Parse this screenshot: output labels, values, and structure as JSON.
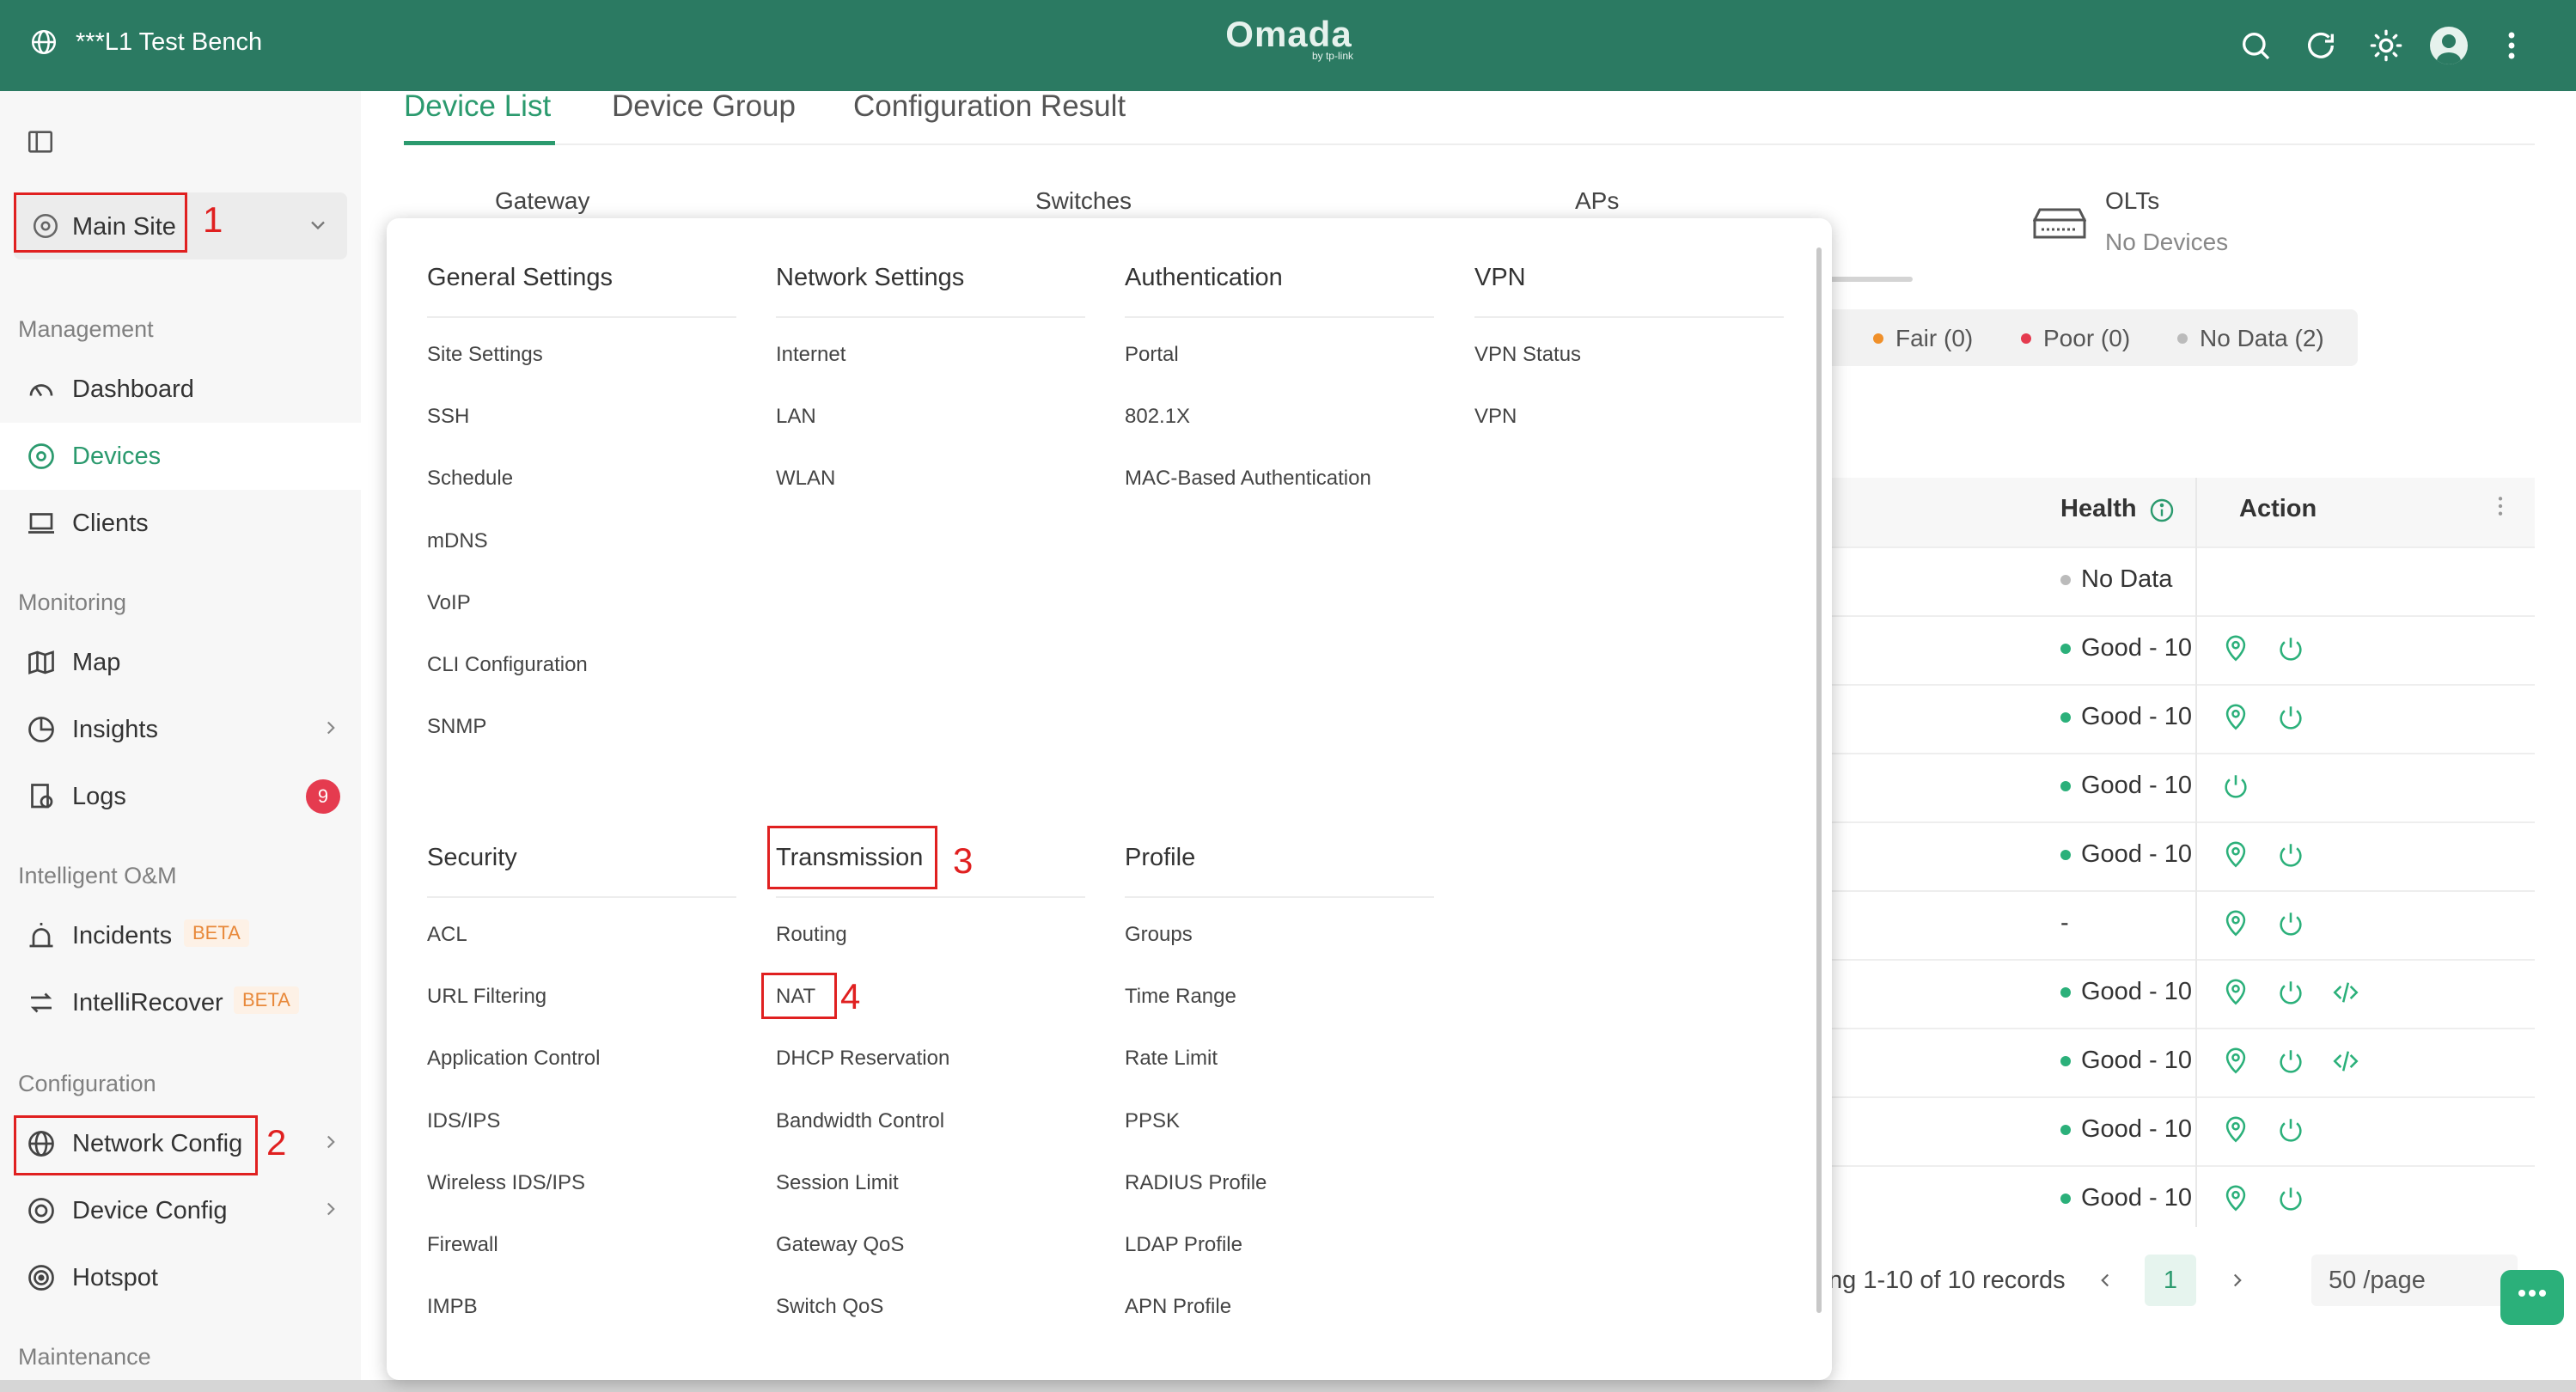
{
  "topbar": {
    "site_name": "***L1 Test Bench",
    "logo_text": "Omada",
    "logo_sub": "by tp-link",
    "icons": [
      "search-icon",
      "refresh-icon",
      "theme-icon",
      "avatar",
      "more-icon"
    ]
  },
  "sidebar": {
    "site_selector": "Main Site",
    "sections": {
      "management": "Management",
      "monitoring": "Monitoring",
      "intelligent": "Intelligent O&M",
      "configuration": "Configuration",
      "maintenance": "Maintenance"
    },
    "items": {
      "dashboard": "Dashboard",
      "devices": "Devices",
      "clients": "Clients",
      "map": "Map",
      "insights": "Insights",
      "logs": "Logs",
      "logs_badge": "9",
      "incidents": "Incidents",
      "intellirecover": "IntelliRecover",
      "beta": "BETA",
      "network_config": "Network Config",
      "device_config": "Device Config",
      "hotspot": "Hotspot"
    }
  },
  "annotations": {
    "n1": "1",
    "n2": "2",
    "n3": "3",
    "n4": "4"
  },
  "tabs": {
    "device_list": "Device List",
    "device_group": "Device Group",
    "config_result": "Configuration Result"
  },
  "categories": {
    "gateway": "Gateway",
    "switches": "Switches",
    "aps": "APs",
    "olts": "OLTs",
    "olts_sub": "No Devices"
  },
  "health_summary": {
    "fair": "Fair (0)",
    "poor": "Poor (0)",
    "nodata": "No Data (2)"
  },
  "table": {
    "health_header": "Health",
    "action_header": "Action",
    "rows": [
      {
        "health": "No Data",
        "status": "nodata",
        "actions": []
      },
      {
        "health": "Good - 10",
        "status": "good",
        "actions": [
          "locate-icon",
          "power-icon"
        ]
      },
      {
        "health": "Good - 10",
        "status": "good",
        "actions": [
          "locate-icon",
          "power-icon"
        ]
      },
      {
        "health": "Good - 10",
        "status": "good",
        "actions": [
          "power-icon"
        ]
      },
      {
        "health": "Good - 10",
        "status": "good",
        "actions": [
          "locate-icon",
          "power-icon"
        ]
      },
      {
        "health": "-",
        "status": "none",
        "actions": [
          "locate-icon",
          "power-icon"
        ]
      },
      {
        "health": "Good - 10",
        "status": "good",
        "actions": [
          "locate-icon",
          "power-icon",
          "code-icon"
        ]
      },
      {
        "health": "Good - 10",
        "status": "good",
        "actions": [
          "locate-icon",
          "power-icon",
          "code-icon"
        ]
      },
      {
        "health": "Good - 10",
        "status": "good",
        "actions": [
          "locate-icon",
          "power-icon"
        ]
      },
      {
        "health": "Good - 10",
        "status": "good",
        "actions": [
          "locate-icon",
          "power-icon"
        ]
      }
    ]
  },
  "pagination": {
    "records": "ng 1-10 of 10 records",
    "page": "1",
    "per_page": "50 /page"
  },
  "menu": {
    "general": {
      "title": "General Settings",
      "items": [
        "Site Settings",
        "SSH",
        "Schedule",
        "mDNS",
        "VoIP",
        "CLI Configuration",
        "SNMP"
      ]
    },
    "network": {
      "title": "Network Settings",
      "items": [
        "Internet",
        "LAN",
        "WLAN"
      ]
    },
    "authentication": {
      "title": "Authentication",
      "items": [
        "Portal",
        "802.1X",
        "MAC-Based Authentication"
      ]
    },
    "vpn": {
      "title": "VPN",
      "items": [
        "VPN Status",
        "VPN"
      ]
    },
    "security": {
      "title": "Security",
      "items": [
        "ACL",
        "URL Filtering",
        "Application Control",
        "IDS/IPS",
        "Wireless IDS/IPS",
        "Firewall",
        "IMPB"
      ]
    },
    "transmission": {
      "title": "Transmission",
      "items": [
        "Routing",
        "NAT",
        "DHCP Reservation",
        "Bandwidth Control",
        "Session Limit",
        "Gateway QoS",
        "Switch QoS"
      ]
    },
    "profile": {
      "title": "Profile",
      "items": [
        "Groups",
        "Time Range",
        "Rate Limit",
        "PPSK",
        "RADIUS Profile",
        "LDAP Profile",
        "APN Profile"
      ]
    }
  },
  "colors": {
    "brand": "#2b7a62",
    "accent": "#2b9a6e",
    "good": "#2bb07a",
    "fair": "#f0902a",
    "poor": "#e53b4f",
    "nodata": "#bbbbbb",
    "annotation": "#e02020"
  }
}
